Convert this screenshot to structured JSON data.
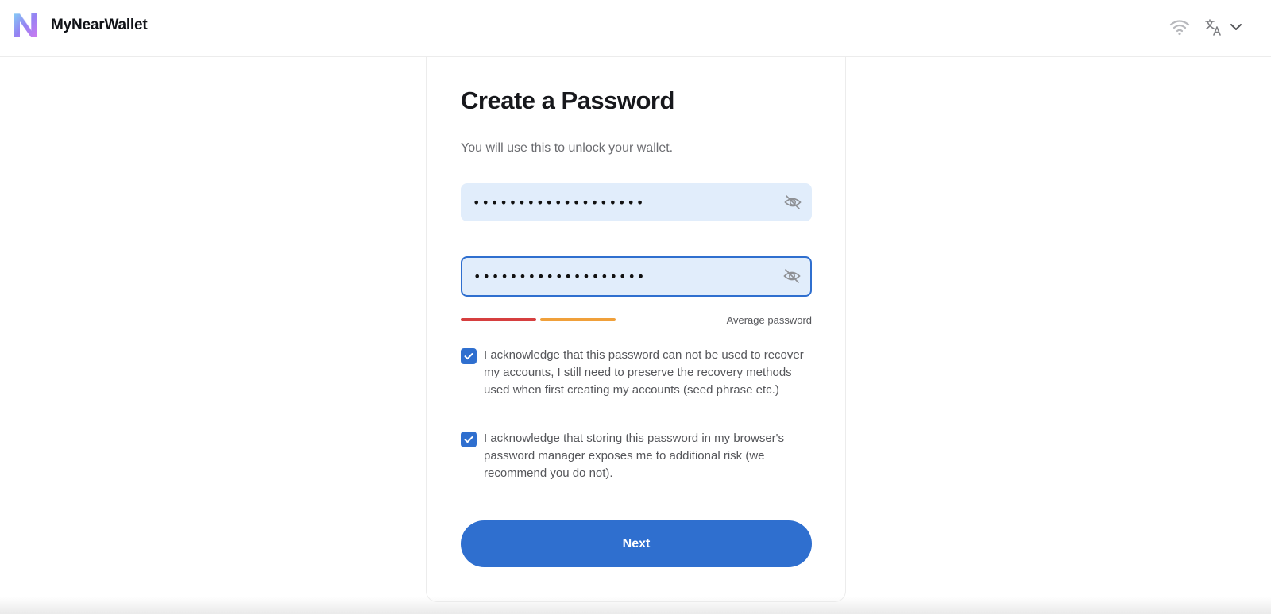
{
  "header": {
    "app_name": "MyNearWallet",
    "icons": [
      "network-status-icon",
      "translate-icon",
      "chevron-down-icon"
    ]
  },
  "card": {
    "title": "Create a Password",
    "subtitle": "You will use this to unlock your wallet.",
    "password_value": "•••••••••••••••••••",
    "confirm_value": "•••••••••••••••••••",
    "strength": {
      "label": "Average password",
      "filled_segments": 2,
      "colors": [
        "#d63f3f",
        "#f0a03a"
      ]
    },
    "checkboxes": [
      {
        "checked": true,
        "text": "I acknowledge that this password can not be used to recover my accounts, I still need to preserve the recovery methods used when first creating my accounts (seed phrase etc.)"
      },
      {
        "checked": true,
        "text": "I acknowledge that storing this password in my browser's password manager exposes me to additional risk (we recommend you do not)."
      }
    ],
    "next_label": "Next"
  },
  "colors": {
    "accent": "#2f6fcf",
    "field_bg": "#e1edfb"
  }
}
